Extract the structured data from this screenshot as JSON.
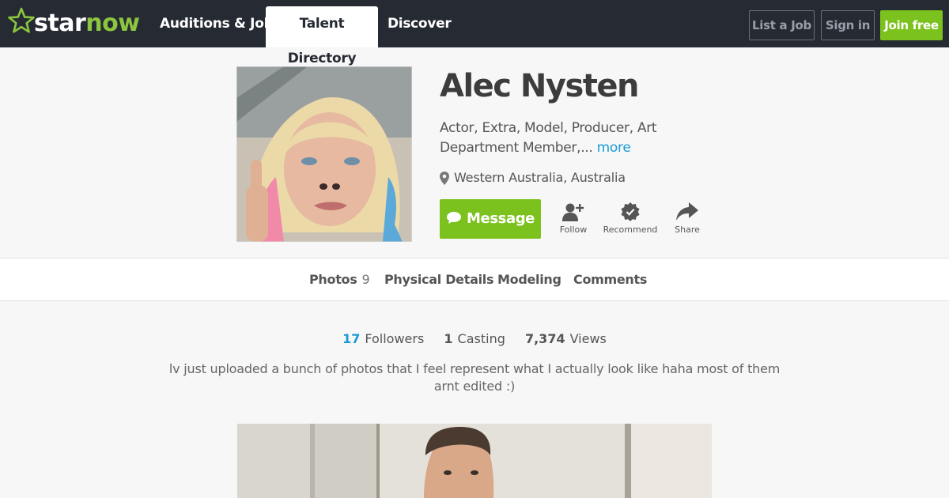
{
  "header": {
    "logo": {
      "star": "star",
      "now": "now",
      "icon": "star-outline-icon"
    },
    "nav": [
      {
        "label": "Auditions & Jobs"
      },
      {
        "label": "Talent Directory",
        "active": true
      },
      {
        "label": "Discover"
      }
    ],
    "buttons": {
      "list_job": "List a Job",
      "sign_in": "Sign in",
      "join": "Join free"
    }
  },
  "profile": {
    "name": "Alec Nysten",
    "roles": "Actor, Extra, Model, Producer, Art Department Member,...",
    "more_label": "more",
    "location": "Western Australia, Australia",
    "message_label": "Message",
    "actions": {
      "follow": "Follow",
      "recommend": "Recommend",
      "share": "Share"
    }
  },
  "tabs": [
    {
      "label": "Photos",
      "count": "9"
    },
    {
      "label": "Physical Details"
    },
    {
      "label": "Modeling"
    },
    {
      "label": "Comments"
    }
  ],
  "stats": {
    "followers": {
      "value": "17",
      "label": "Followers"
    },
    "casting": {
      "value": "1",
      "label": "Casting"
    },
    "views": {
      "value": "7,374",
      "label": "Views"
    }
  },
  "bio": "lv just uploaded a bunch of photos that I feel represent what I actually look like haha most of them arnt edited :)",
  "colors": {
    "topbar": "#262a33",
    "brand_green": "#7cc21e",
    "logo_green": "#8cc63f",
    "link_blue": "#1a9bd6"
  }
}
